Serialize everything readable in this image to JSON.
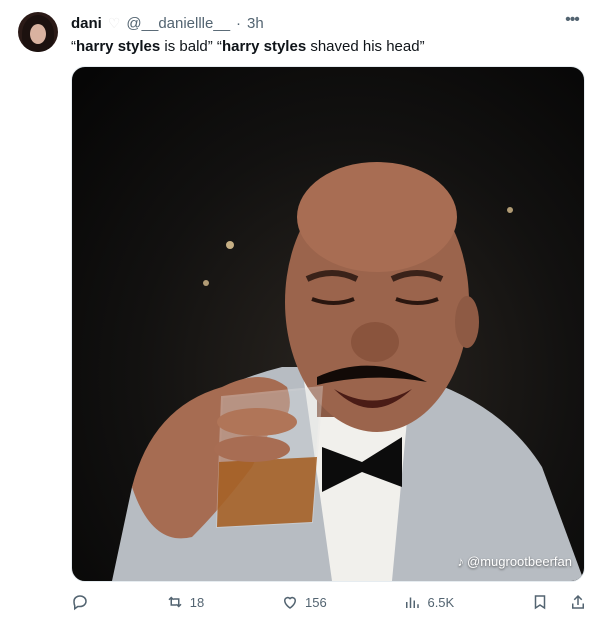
{
  "author": {
    "name": "dani",
    "handle": "@__daniellle__",
    "separator": "·",
    "time": "3h"
  },
  "tweet": {
    "part1_bold": "harry styles",
    "part1_rest": " is bald”",
    "open_quote1": "“",
    "open_quote2": " “",
    "part2_bold": "harry styles",
    "part2_rest": " shaved his head”"
  },
  "media": {
    "watermark": "@mugrootbeerfan"
  },
  "actions": {
    "retweets": "18",
    "likes": "156",
    "views": "6.5K"
  },
  "icons": {
    "more": "more-horizontal-icon",
    "reply": "reply-icon",
    "retweet": "retweet-icon",
    "like": "heart-icon",
    "views": "views-chart-icon",
    "bookmark": "bookmark-icon",
    "share": "share-icon",
    "tiktok": "tiktok-icon"
  },
  "colors": {
    "text": "#0f1419",
    "secondary": "#536471"
  }
}
